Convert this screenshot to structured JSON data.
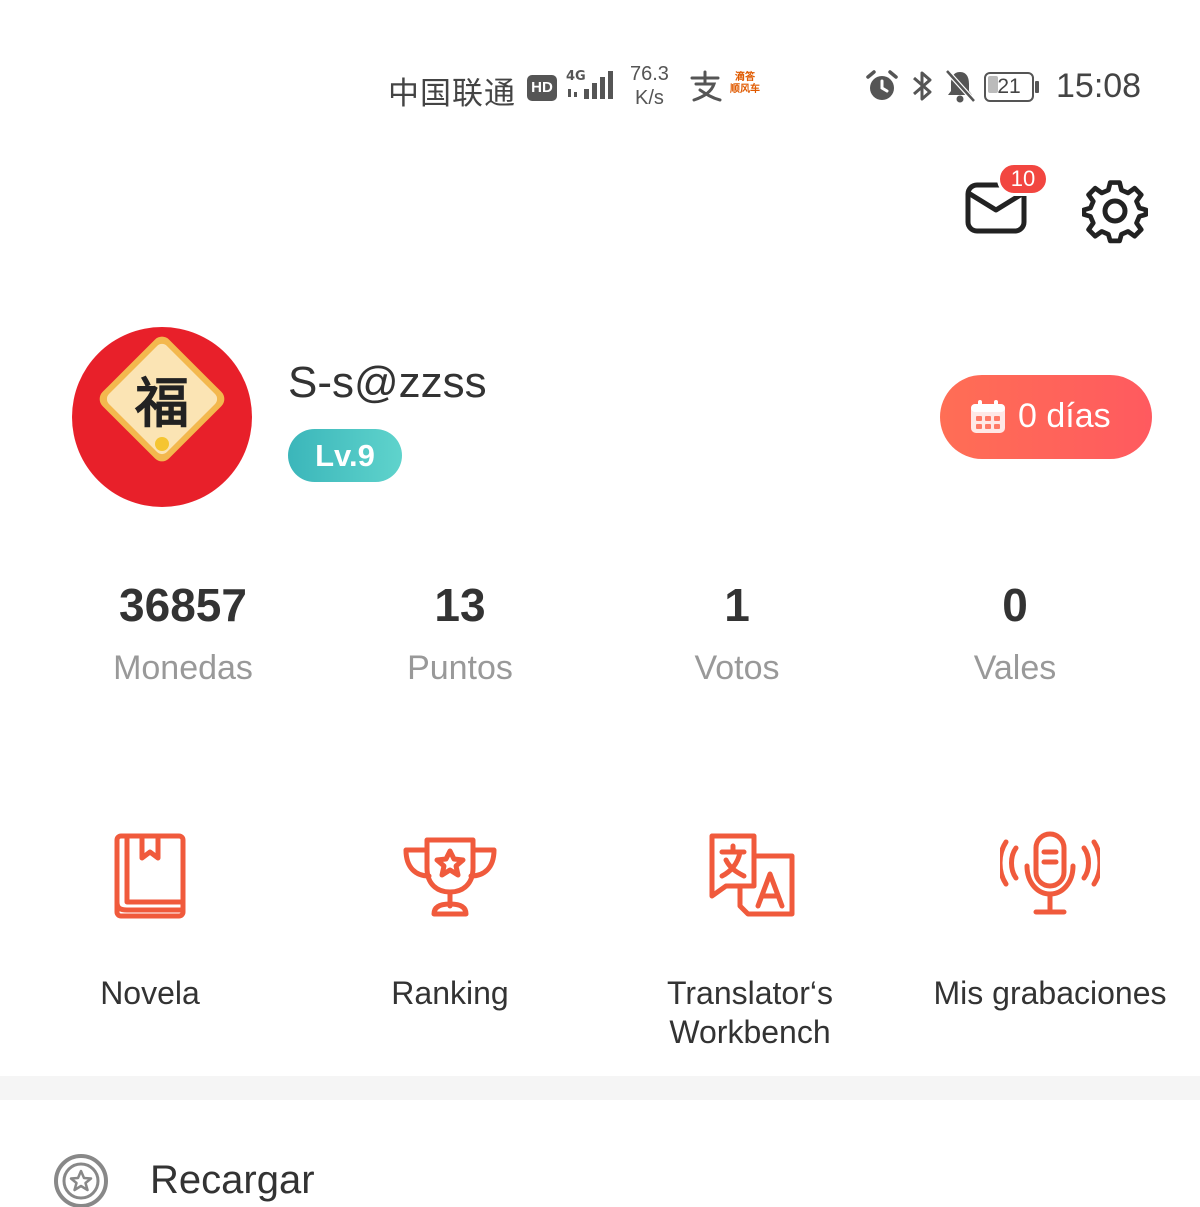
{
  "status_bar": {
    "carrier": "中国联通",
    "hd_badge": "HD",
    "network": "4G",
    "speed_value": "76.3",
    "speed_unit": "K/s",
    "battery_level": "21",
    "time": "15:08"
  },
  "header": {
    "mail_badge_count": "10"
  },
  "profile": {
    "username": "S-s@zzss",
    "level": "Lv.9",
    "avatar_glyph": "福",
    "checkin_label": "0 días"
  },
  "stats": [
    {
      "value": "36857",
      "label": "Monedas"
    },
    {
      "value": "13",
      "label": "Puntos"
    },
    {
      "value": "1",
      "label": "Votos"
    },
    {
      "value": "0",
      "label": "Vales"
    }
  ],
  "features": [
    {
      "label": "Novela",
      "icon": "book-icon"
    },
    {
      "label": "Ranking",
      "icon": "trophy-icon"
    },
    {
      "label": "Translator's Workbench",
      "label_line1": "Translator‘s",
      "label_line2": "Workbench",
      "icon": "translate-icon"
    },
    {
      "label": "Mis grabaciones",
      "icon": "microphone-icon"
    }
  ],
  "menu": {
    "recharge_label": "Recargar"
  },
  "colors": {
    "accent": "#f05a3c",
    "badge_red": "#f24640",
    "level_teal": "#44c2c0",
    "checkin_gradient_start": "#ff6e55",
    "avatar_red": "#e8202a"
  }
}
